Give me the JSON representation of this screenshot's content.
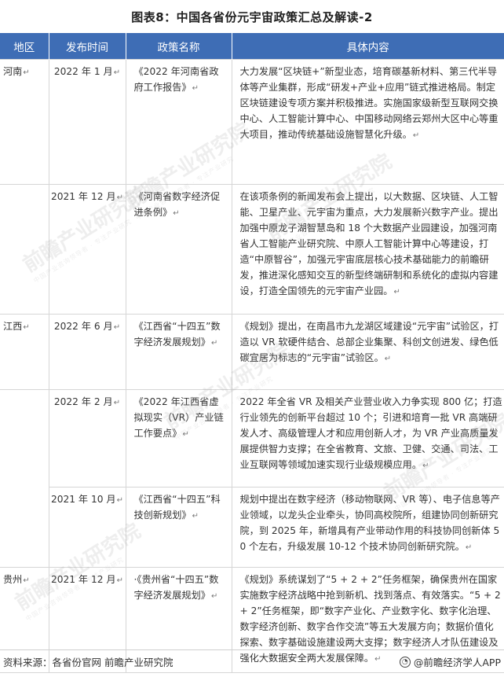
{
  "title": "图表8：中国各省份元宇宙政策汇总及解读-2",
  "table": {
    "headers": [
      "地区",
      "发布时间",
      "政策名称",
      "具体内容"
    ],
    "rows": [
      {
        "region": "河南",
        "date": "2022 年 1 月",
        "name": "《2022 年河南省政府工作报告》",
        "content": "大力发展“区块链+”新型业态，培育碳基新材料、第三代半导体等产业集群，形成“研发+产业+应用”链式推进格局。制定区块链建设专项方案并积极推进。实施国家级新型互联网交换中心、人工智能计算中心、中国移动网络云郑州大区中心等重大项目，推动传统基础设施智慧化升级。"
      },
      {
        "region": "",
        "date": "2021 年 12 月",
        "name": "《河南省数字经济促进条例》",
        "content": "在该项条例的新闻发布会上提出，以大数据、区块链、人工智能、卫星产业、元宇宙为重点，大力发展新兴数字产业。提出加强中原龙子湖智慧岛和 18 个大数据产业园建设，加强河南省人工智能产业研究院、中原人工智能计算中心等建设，打造“中原智谷”，加强元宇宙底层核心技术基础能力的前瞻研发，推进深化感知交互的新型终端研制和系统化的虚拟内容建设，打造全国领先的元宇宙产业园。"
      },
      {
        "region": "江西",
        "date": "2022 年 6 月",
        "name": "《江西省“十四五”数字经济发展规划》",
        "content": "《规划》提出，在南昌市九龙湖区域建设“元宇宙”试验区，打造以 VR 软硬件结合、总部企业集聚、科创文创进发、绿色低碳宜居为标志的“元宇宙”试验区。"
      },
      {
        "region": "",
        "date": "2022 年 2 月",
        "name": "《2022 年江西省虚拟现实（VR）产业链工作要点》",
        "content": "2022 年全省 VR 及相关产业营业收入力争实现 800 亿；打造行业领先的创新平台超过 10 个；引进和培育一批 VR 高端研发人才、高级管理人才和应用创新人才，为 VR 产业高质量发展提供智力支撑；在全省教育、文旅、卫健、交通、司法、工业互联网等领域加速实现行业级规模应用。"
      },
      {
        "region": "",
        "date": "2021 年 10 月",
        "name": "《江西省“十四五”科技创新规划》",
        "content": "规划中提出在数字经济（移动物联网、VR 等）、电子信息等产业领域，以龙头企业牵头，协同高校院所，组建协同创新研究院，到 2025 年，新增具有产业带动作用的科技协同创新体 50 个左右，升级发展 10-12 个技术协同创新研究院。"
      },
      {
        "region": "贵州",
        "date": "2021 年 12 月",
        "name": "·《贵州省“十四五”数字经济发展规划》",
        "content": "《规划》系统谋划了“5 + 2 + 2”任务框架，确保贵州在国家实施数字经济战略中抢到新机、找到落点、有效落实。“5 + 2 + 2”任务框架，即“数字产业化、产业数字化、数字化治理、数字经济创新、数字合作交流”等五大发展方向；数据价值化探索、数字基础设施建设两大支撑；数字经济人才队伍建设及强化大数据安全两大发展保障。"
      }
    ]
  },
  "watermark": {
    "text": "前瞻产业研究院",
    "sub": "中国产业咨询领导者 · 专注产业研究"
  },
  "footer": {
    "source": "资料来源：各省份官网 前瞻产业研究院",
    "brand": "@前瞻经济学人APP"
  }
}
